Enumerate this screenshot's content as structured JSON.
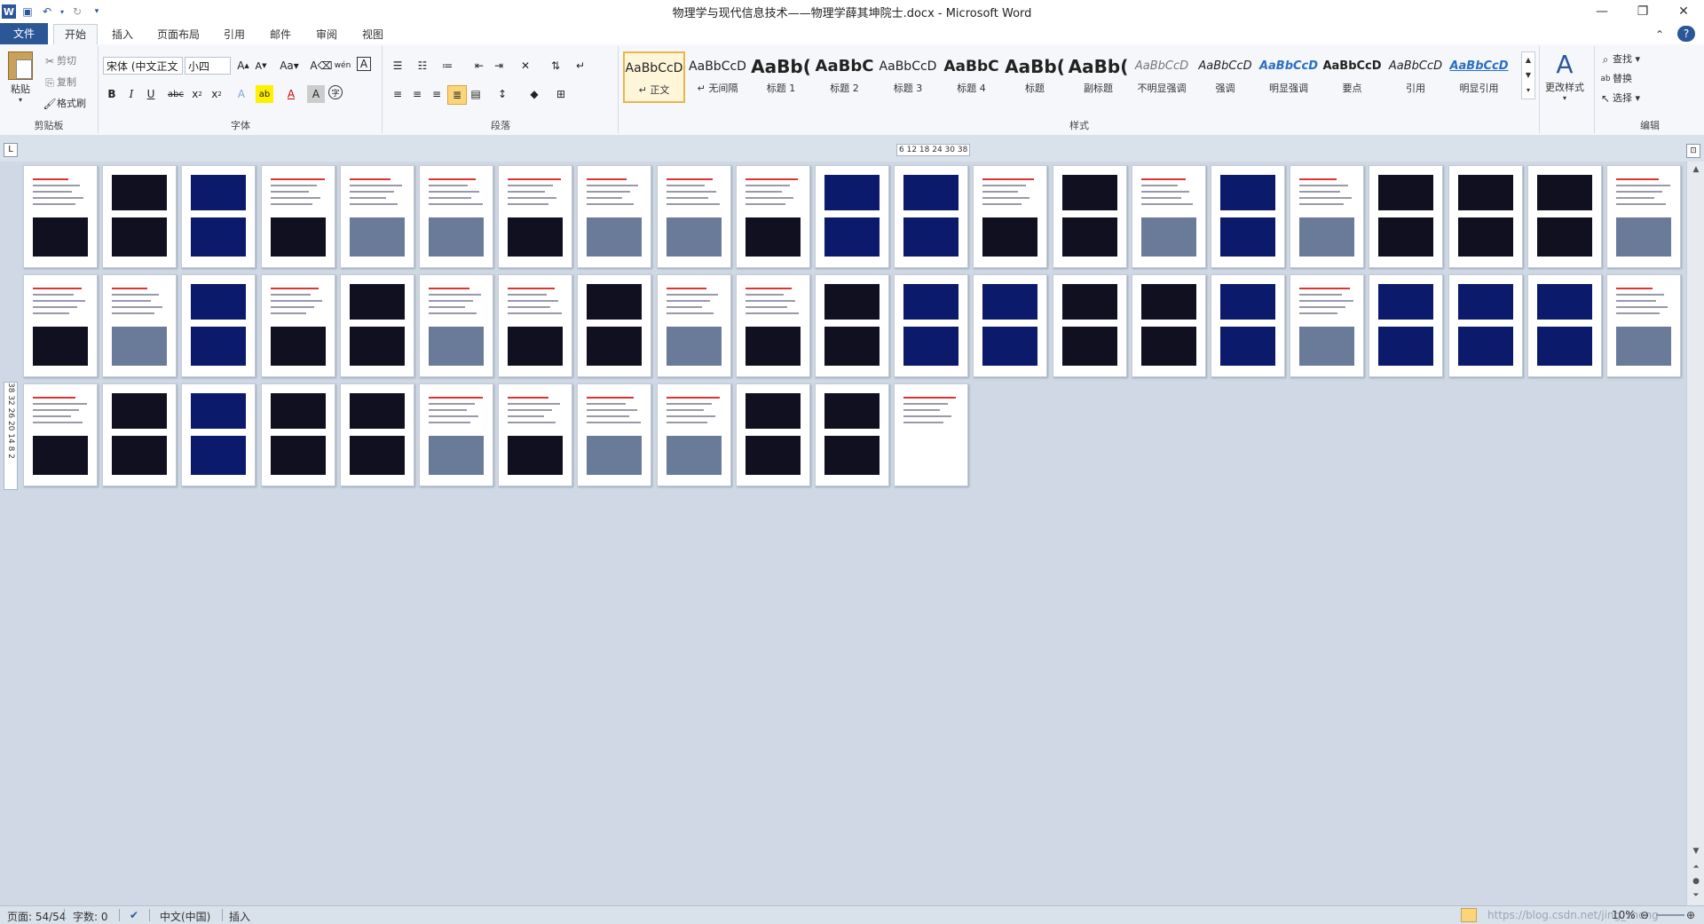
{
  "window": {
    "title": "物理学与现代信息技术——物理学薛其坤院士.docx - Microsoft Word",
    "app_icon": "word-icon",
    "quick_access": [
      "save-icon",
      "undo-icon",
      "redo-icon",
      "customize-icon"
    ],
    "controls": {
      "minimize": "—",
      "restore": "❐",
      "close": "✕"
    }
  },
  "tabs": {
    "file": "文件",
    "home": "开始",
    "insert": "插入",
    "layout": "页面布局",
    "references": "引用",
    "mailings": "邮件",
    "review": "审阅",
    "view": "视图"
  },
  "ribbon": {
    "clipboard": {
      "label": "剪贴板",
      "paste": "粘贴",
      "cut": "剪切",
      "copy": "复制",
      "format_painter": "格式刷"
    },
    "font": {
      "label": "字体",
      "font_name": "宋体 (中文正文",
      "font_size": "小四"
    },
    "paragraph": {
      "label": "段落"
    },
    "styles": {
      "label": "样式",
      "items": [
        {
          "sample": "AaBbCcD",
          "name": "↵ 正文"
        },
        {
          "sample": "AaBbCcD",
          "name": "↵ 无间隔"
        },
        {
          "sample": "AaBb(",
          "name": "标题 1"
        },
        {
          "sample": "AaBbC",
          "name": "标题 2"
        },
        {
          "sample": "AaBbCcD",
          "name": "标题 3"
        },
        {
          "sample": "AaBbC",
          "name": "标题 4"
        },
        {
          "sample": "AaBb(",
          "name": "标题"
        },
        {
          "sample": "AaBb(",
          "name": "副标题"
        },
        {
          "sample": "AaBbCcD",
          "name": "不明显强调"
        },
        {
          "sample": "AaBbCcD",
          "name": "强调"
        },
        {
          "sample": "AaBbCcD",
          "name": "明显强调"
        },
        {
          "sample": "AaBbCcD",
          "name": "要点"
        },
        {
          "sample": "AaBbCcD",
          "name": "引用"
        },
        {
          "sample": "AaBbCcD",
          "name": "明显引用"
        }
      ],
      "change_styles": "更改样式"
    },
    "editing": {
      "label": "编辑",
      "find": "查找",
      "replace": "替换",
      "select": "选择"
    }
  },
  "ruler": {
    "horizontal": "6 12 18 24 30 38",
    "vertical": "38 32 26 20 14 8 2"
  },
  "document": {
    "page_count": 54,
    "page_colors": {
      "dark": "#101020",
      "navy": "#0b1a6b",
      "white": "#ffffff"
    }
  },
  "status": {
    "page": "页面: 54/54",
    "words": "字数: 0",
    "language": "中文(中国)",
    "mode": "插入",
    "zoom": "10%",
    "watermark": "https://blog.csdn.net/jing_zhong"
  }
}
